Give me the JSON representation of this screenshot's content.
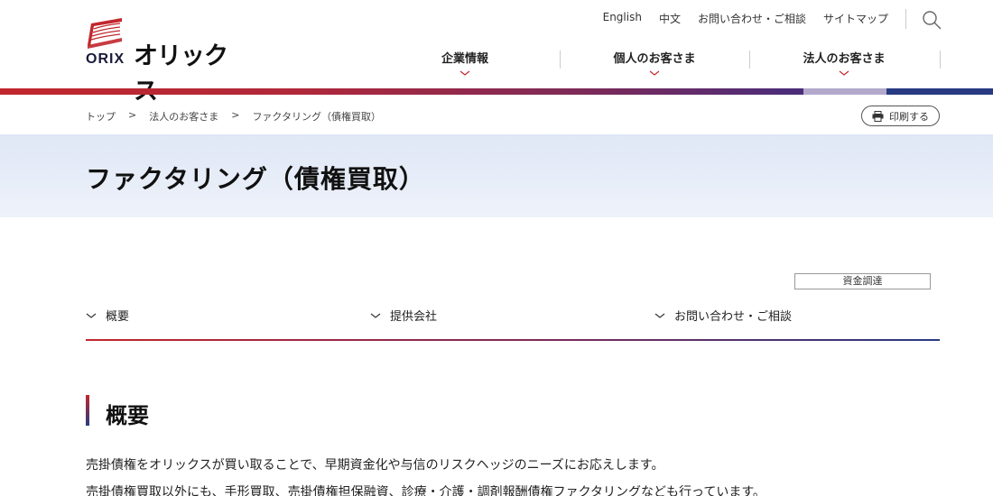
{
  "brand": {
    "logo_en": "ORIX",
    "logo_ja": "オリックス",
    "colors": {
      "red": "#c1272d",
      "purple": "#4b2d7a",
      "lavender": "#b3a9cc",
      "navy": "#283a82"
    }
  },
  "util_nav": [
    "English",
    "中文",
    "お問い合わせ・ご相談",
    "サイトマップ"
  ],
  "main_nav": [
    "企業情報",
    "個人のお客さま",
    "法人のお客さま"
  ],
  "breadcrumb": [
    "トップ",
    ">",
    "法人のお客さま",
    ">",
    "ファクタリング（債権買取）"
  ],
  "print_label": "印刷する",
  "page_title": "ファクタリング（債権買取）",
  "tag": "資金調達",
  "anchor_nav": [
    "概要",
    "提供会社",
    "お問い合わせ・ご相談"
  ],
  "section": {
    "title": "概要",
    "paragraphs": [
      "売掛債権をオリックスが買い取ることで、早期資金化や与信のリスクヘッジのニーズにお応えします。",
      "売掛債権買取以外にも、手形買取、売掛債権担保融資、診療・介護・調剤報酬債権ファクタリングなども行っています。"
    ]
  }
}
